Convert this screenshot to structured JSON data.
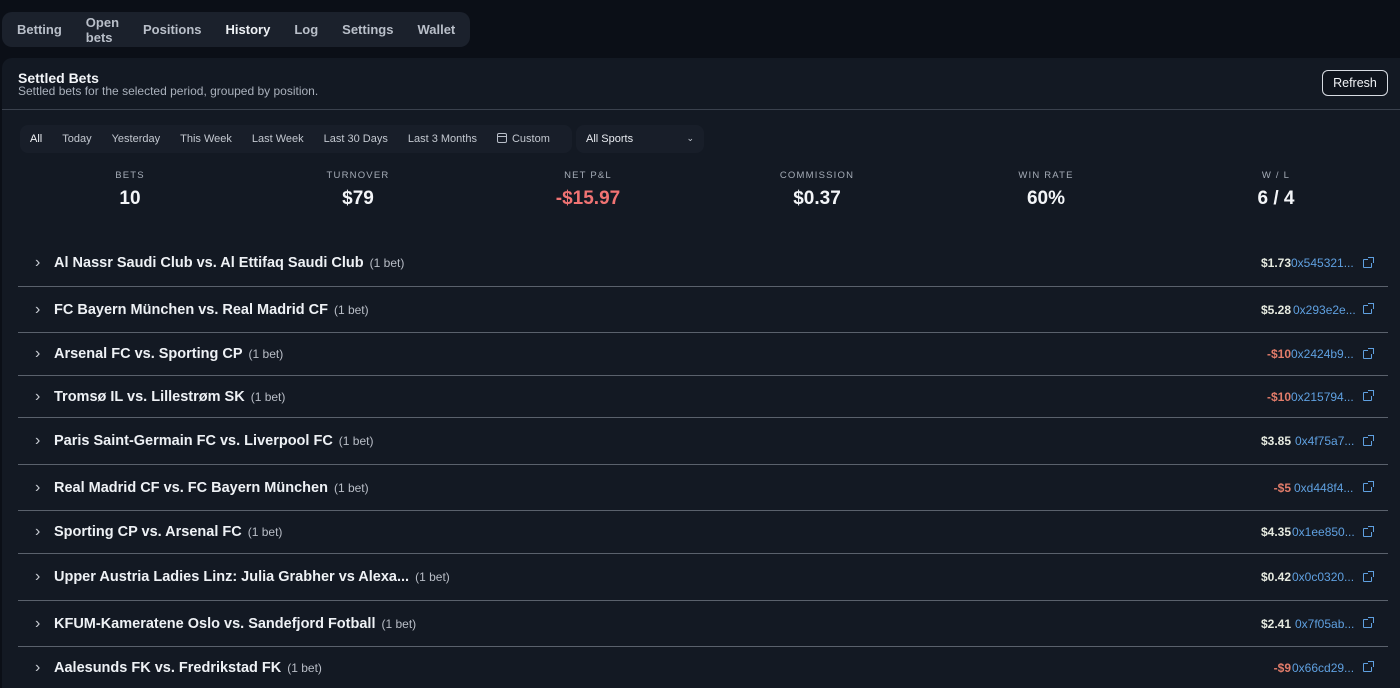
{
  "nav": {
    "tabs": [
      {
        "label": "Betting"
      },
      {
        "label": "Open bets"
      },
      {
        "label": "Positions"
      },
      {
        "label": "History"
      },
      {
        "label": "Log"
      },
      {
        "label": "Settings"
      },
      {
        "label": "Wallet"
      }
    ],
    "active": "History"
  },
  "panel": {
    "title": "Settled Bets",
    "subtitle": "Settled bets for the selected period, grouped by position.",
    "refresh_label": "Refresh"
  },
  "filters": {
    "periods": [
      "All",
      "Today",
      "Yesterday",
      "This Week",
      "Last Week",
      "Last 30 Days",
      "Last 3 Months"
    ],
    "custom_label": "Custom",
    "selected_period": "All",
    "sport_select": "All Sports"
  },
  "stats": {
    "bets": {
      "label": "BETS",
      "value": "10"
    },
    "turnover": {
      "label": "TURNOVER",
      "value": "$79"
    },
    "net_pnl": {
      "label": "NET P&L",
      "value": "-$15.97"
    },
    "commission": {
      "label": "COMMISSION",
      "value": "$0.37"
    },
    "win_rate": {
      "label": "WIN RATE",
      "value": "60%"
    },
    "wl": {
      "label": "W / L",
      "value": "6 / 4"
    }
  },
  "positions": [
    {
      "name": "Al Nassr Saudi Club vs. Al Ettifaq Saudi Club",
      "count": "(1 bet)",
      "amount": "$1.73",
      "hash": "0x545321...",
      "negative": false
    },
    {
      "name": "FC Bayern München vs. Real Madrid CF",
      "count": "(1 bet)",
      "amount": "$5.28",
      "hash": "0x293e2e...",
      "negative": false
    },
    {
      "name": "Arsenal FC vs. Sporting CP",
      "count": "(1 bet)",
      "amount": "-$10",
      "hash": "0x2424b9...",
      "negative": true
    },
    {
      "name": "Tromsø IL vs. Lillestrøm SK",
      "count": "(1 bet)",
      "amount": "-$10",
      "hash": "0x215794...",
      "negative": true
    },
    {
      "name": "Paris Saint-Germain FC vs. Liverpool FC",
      "count": "(1 bet)",
      "amount": "$3.85",
      "hash": "0x4f75a7...",
      "negative": false
    },
    {
      "name": "Real Madrid CF vs. FC Bayern München",
      "count": "(1 bet)",
      "amount": "-$5",
      "hash": "0xd448f4...",
      "negative": true
    },
    {
      "name": "Sporting CP vs. Arsenal FC",
      "count": "(1 bet)",
      "amount": "$4.35",
      "hash": "0x1ee850...",
      "negative": false
    },
    {
      "name": "Upper Austria Ladies Linz: Julia Grabher vs Alexa...",
      "count": "(1 bet)",
      "amount": "$0.42",
      "hash": "0x0c0320...",
      "negative": false
    },
    {
      "name": "KFUM-Kameratene Oslo vs. Sandefjord Fotball",
      "count": "(1 bet)",
      "amount": "$2.41",
      "hash": "0x7f05ab...",
      "negative": false
    },
    {
      "name": "Aalesunds FK vs. Fredrikstad FK",
      "count": "(1 bet)",
      "amount": "-$9",
      "hash": "0x66cd29...",
      "negative": true
    }
  ],
  "colors": {
    "background": "#0b0f17",
    "panel": "#131923",
    "negative": "#f07373",
    "link": "#5fa0e0"
  }
}
